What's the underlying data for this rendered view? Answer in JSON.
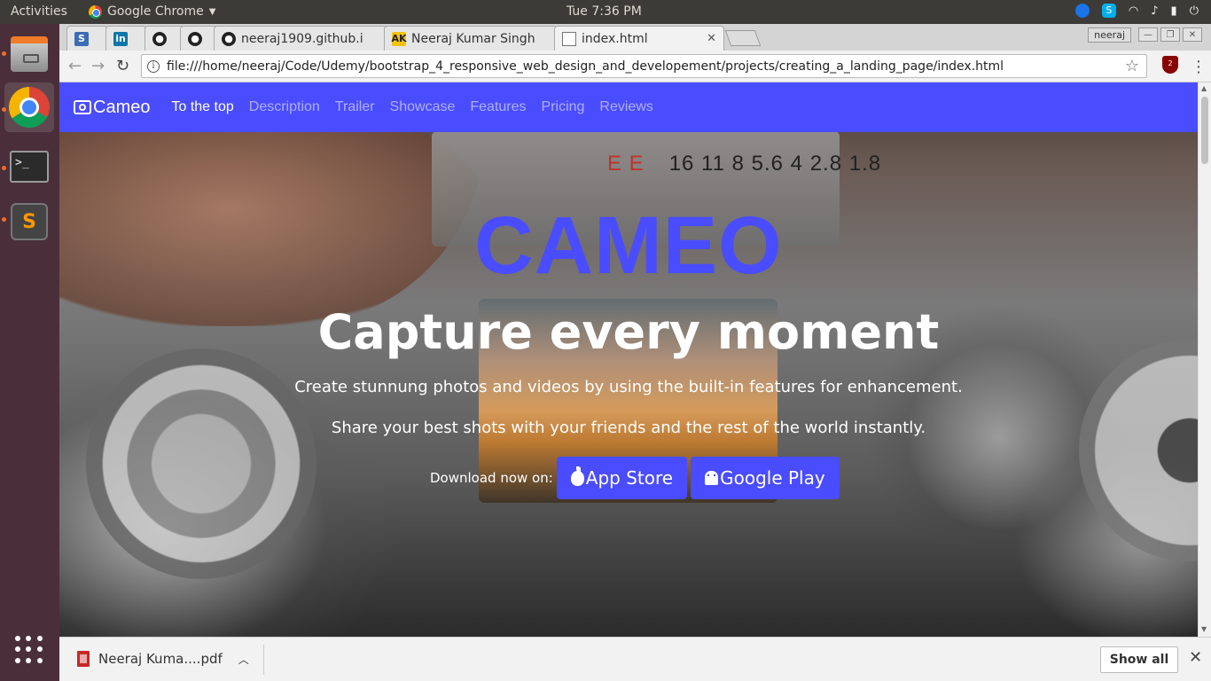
{
  "topbar": {
    "activities": "Activities",
    "app_name": "Google Chrome",
    "clock": "Tue  7:36 PM"
  },
  "tabs": [
    {
      "label": "",
      "favicon": "S"
    },
    {
      "label": "",
      "favicon": "in"
    },
    {
      "label": "",
      "favicon": "github"
    },
    {
      "label": "",
      "favicon": "github"
    },
    {
      "label": "neeraj1909.github.i",
      "favicon": "github"
    },
    {
      "label": "Neeraj Kumar Singh",
      "favicon": "AK"
    },
    {
      "label": "index.html",
      "favicon": "document"
    }
  ],
  "window": {
    "user": "neeraj"
  },
  "address_bar": {
    "url": "file:///home/neeraj/Code/Udemy/bootstrap_4_responsive_web_design_and_developement/projects/creating_a_landing_page/index.html",
    "ublock_count": "2"
  },
  "page": {
    "brand": "Cameo",
    "nav": [
      "To the top",
      "Description",
      "Trailer",
      "Showcase",
      "Features",
      "Pricing",
      "Reviews"
    ],
    "active_nav": "To the top",
    "title": "CAMEO",
    "tagline": "Capture every moment",
    "para1": "Create stunnung photos and videos by using the built-in features for enhancement.",
    "para2": "Share your best shots with your friends and the rest of the world instantly.",
    "download_label": "Download now on:",
    "app_store": "App Store",
    "google_play": "Google Play",
    "accent_color": "#4a4cff"
  },
  "downloads": {
    "file": "Neeraj Kuma....pdf",
    "show_all": "Show all"
  }
}
